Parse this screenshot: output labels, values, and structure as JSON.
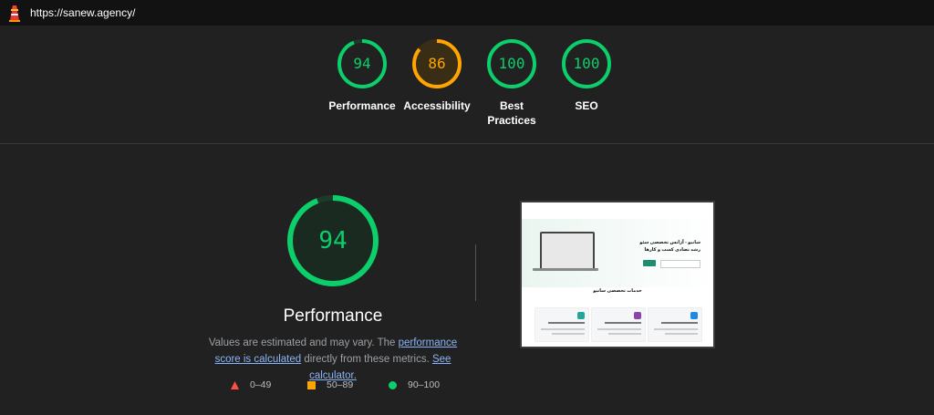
{
  "topbar": {
    "url": "https://sanew.agency/",
    "logo_icon": "lighthouse-icon"
  },
  "categories": [
    {
      "score": "94",
      "label": "Performance",
      "color": "#0cce6b",
      "fill": 0.94
    },
    {
      "score": "86",
      "label": "Accessibility",
      "color": "#ffa400",
      "fill": 0.86
    },
    {
      "score": "100",
      "label": "Best Practices",
      "color": "#0cce6b",
      "fill": 1.0
    },
    {
      "score": "100",
      "label": "SEO",
      "color": "#0cce6b",
      "fill": 1.0
    }
  ],
  "performance": {
    "score": "94",
    "fill": 0.94,
    "title": "Performance",
    "desc_part1": "Values are estimated and may vary. The ",
    "desc_link1": "performance score is calculated",
    "desc_part2": " directly from these metrics. ",
    "desc_link2": "See calculator."
  },
  "legend": [
    {
      "range": "0–49",
      "icon": "triangle-icon",
      "color": "#ff4e42"
    },
    {
      "range": "50–89",
      "icon": "square-icon",
      "color": "#ffa400"
    },
    {
      "range": "90–100",
      "icon": "circle-icon",
      "color": "#0cce6b"
    }
  ],
  "screenshot": {
    "hero_title_1": "سانیو - آژانس تخصصی سئو",
    "hero_title_2": "رشد تضادی کسب و کارها",
    "section_title": "خدمات تخصصی سانیو"
  }
}
